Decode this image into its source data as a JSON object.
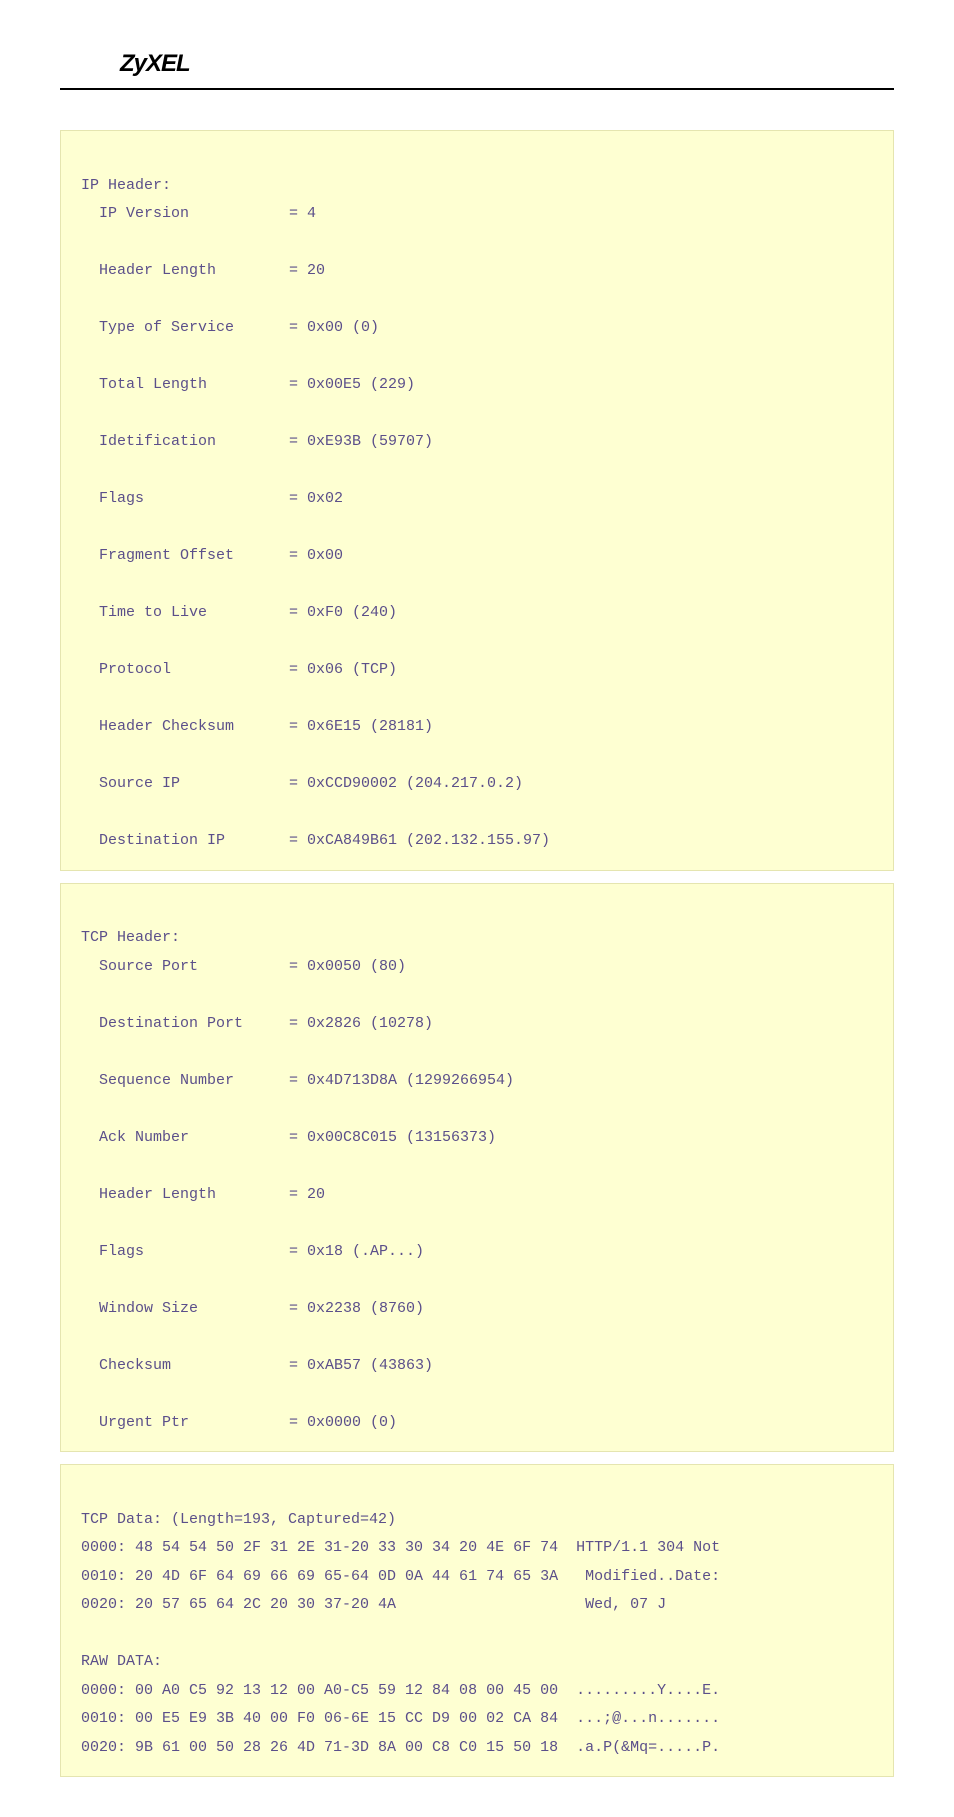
{
  "brand": "ZyXEL",
  "ip_header": {
    "title": "IP Header:",
    "fields": [
      {
        "label": "IP Version",
        "value": "= 4"
      },
      {
        "label": "Header Length",
        "value": "= 20"
      },
      {
        "label": "Type of Service",
        "value": "= 0x00 (0)"
      },
      {
        "label": "Total Length",
        "value": "= 0x00E5 (229)"
      },
      {
        "label": "Idetification",
        "value": "= 0xE93B (59707)"
      },
      {
        "label": "Flags",
        "value": "= 0x02"
      },
      {
        "label": "Fragment Offset",
        "value": "= 0x00"
      },
      {
        "label": "Time to Live",
        "value": "= 0xF0 (240)"
      },
      {
        "label": "Protocol",
        "value": "= 0x06 (TCP)"
      },
      {
        "label": "Header Checksum",
        "value": "= 0x6E15 (28181)"
      },
      {
        "label": "Source IP",
        "value": "= 0xCCD90002 (204.217.0.2)"
      },
      {
        "label": "Destination IP",
        "value": "= 0xCA849B61 (202.132.155.97)"
      }
    ]
  },
  "tcp_header": {
    "title": "TCP Header:",
    "fields": [
      {
        "label": "Source Port",
        "value": "= 0x0050 (80)"
      },
      {
        "label": "Destination Port",
        "value": "= 0x2826 (10278)"
      },
      {
        "label": "Sequence Number",
        "value": "= 0x4D713D8A (1299266954)"
      },
      {
        "label": "Ack Number",
        "value": "= 0x00C8C015 (13156373)"
      },
      {
        "label": "Header Length",
        "value": "= 20"
      },
      {
        "label": "Flags",
        "value": "= 0x18 (.AP...)"
      },
      {
        "label": "Window Size",
        "value": "= 0x2238 (8760)"
      },
      {
        "label": "Checksum",
        "value": "= 0xAB57 (43863)"
      },
      {
        "label": "Urgent Ptr",
        "value": "= 0x0000 (0)"
      }
    ]
  },
  "tcp_data": {
    "title": "TCP Data: (Length=193, Captured=42)",
    "lines": [
      "0000: 48 54 54 50 2F 31 2E 31-20 33 30 34 20 4E 6F 74  HTTP/1.1 304 Not",
      "0010: 20 4D 6F 64 69 66 69 65-64 0D 0A 44 61 74 65 3A   Modified..Date:",
      "0020: 20 57 65 64 2C 20 30 37-20 4A                     Wed, 07 J"
    ]
  },
  "raw_data": {
    "title": "RAW DATA:",
    "lines": [
      "0000: 00 A0 C5 92 13 12 00 A0-C5 59 12 84 08 00 45 00  .........Y....E.",
      "0010: 00 E5 E9 3B 40 00 F0 06-6E 15 CC D9 00 02 CA 84  ...;@...n.......",
      "0020: 9B 61 00 50 28 26 4D 71-3D 8A 00 C8 C0 15 50 18  .a.P(&Mq=.....P."
    ]
  }
}
